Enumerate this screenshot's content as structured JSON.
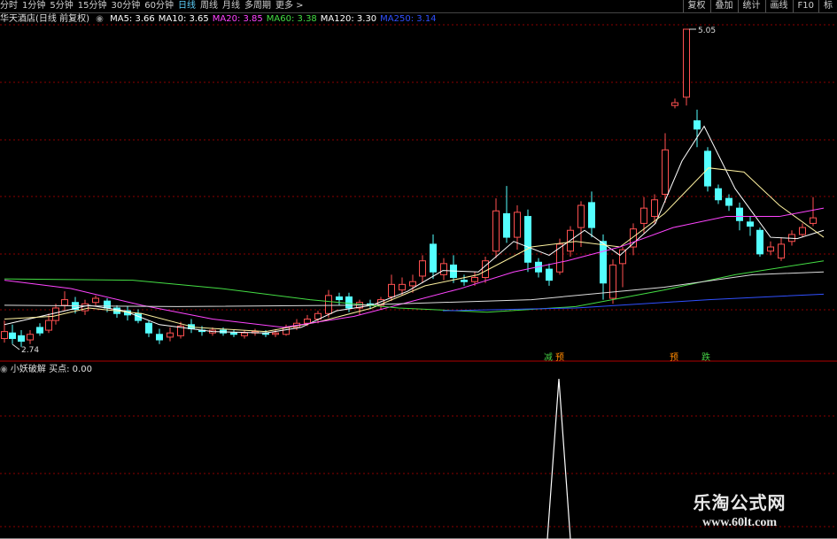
{
  "toolbar": {
    "periods": [
      "分时",
      "1分钟",
      "5分钟",
      "15分钟",
      "30分钟",
      "60分钟",
      "日线",
      "周线",
      "月线",
      "多周期",
      "更多 >"
    ],
    "active_period": "日线",
    "buttons": [
      "复权",
      "叠加",
      "统计",
      "画线",
      "F10",
      "标"
    ]
  },
  "main_panel": {
    "title": "华天酒店(日线 前复权)",
    "ma_labels": [
      {
        "name": "MA5",
        "value": "3.66",
        "color": "#ffffff"
      },
      {
        "name": "MA10",
        "value": "3.65",
        "color": "#ffffff"
      },
      {
        "name": "MA20",
        "value": "3.85",
        "color": "#ff44ff"
      },
      {
        "name": "MA60",
        "value": "3.38",
        "color": "#44dd44"
      },
      {
        "name": "MA120",
        "value": "3.30",
        "color": "#ffffff"
      },
      {
        "name": "MA250",
        "value": "3.14",
        "color": "#3050ff"
      }
    ],
    "high_label": "5.05",
    "low_label": "2.74",
    "signals": [
      {
        "text": "减",
        "color": "#44cc44"
      },
      {
        "text": "预",
        "color": "#ff8800"
      },
      {
        "text": "预",
        "color": "#ff8800"
      },
      {
        "text": "跌",
        "color": "#44cc44"
      }
    ]
  },
  "indicator_panel": {
    "name": "小妖破解",
    "buy_label": "买点:",
    "buy_value": "0.00"
  },
  "watermark": {
    "line1": "乐淘公式网",
    "line2": "www.60lt.com"
  },
  "colors": {
    "up": "#ff5050",
    "down": "#54ffff",
    "grid": "#8b0000",
    "ma20": "#ff44ff",
    "ma60": "#44dd44",
    "ma250": "#3050ff"
  }
}
